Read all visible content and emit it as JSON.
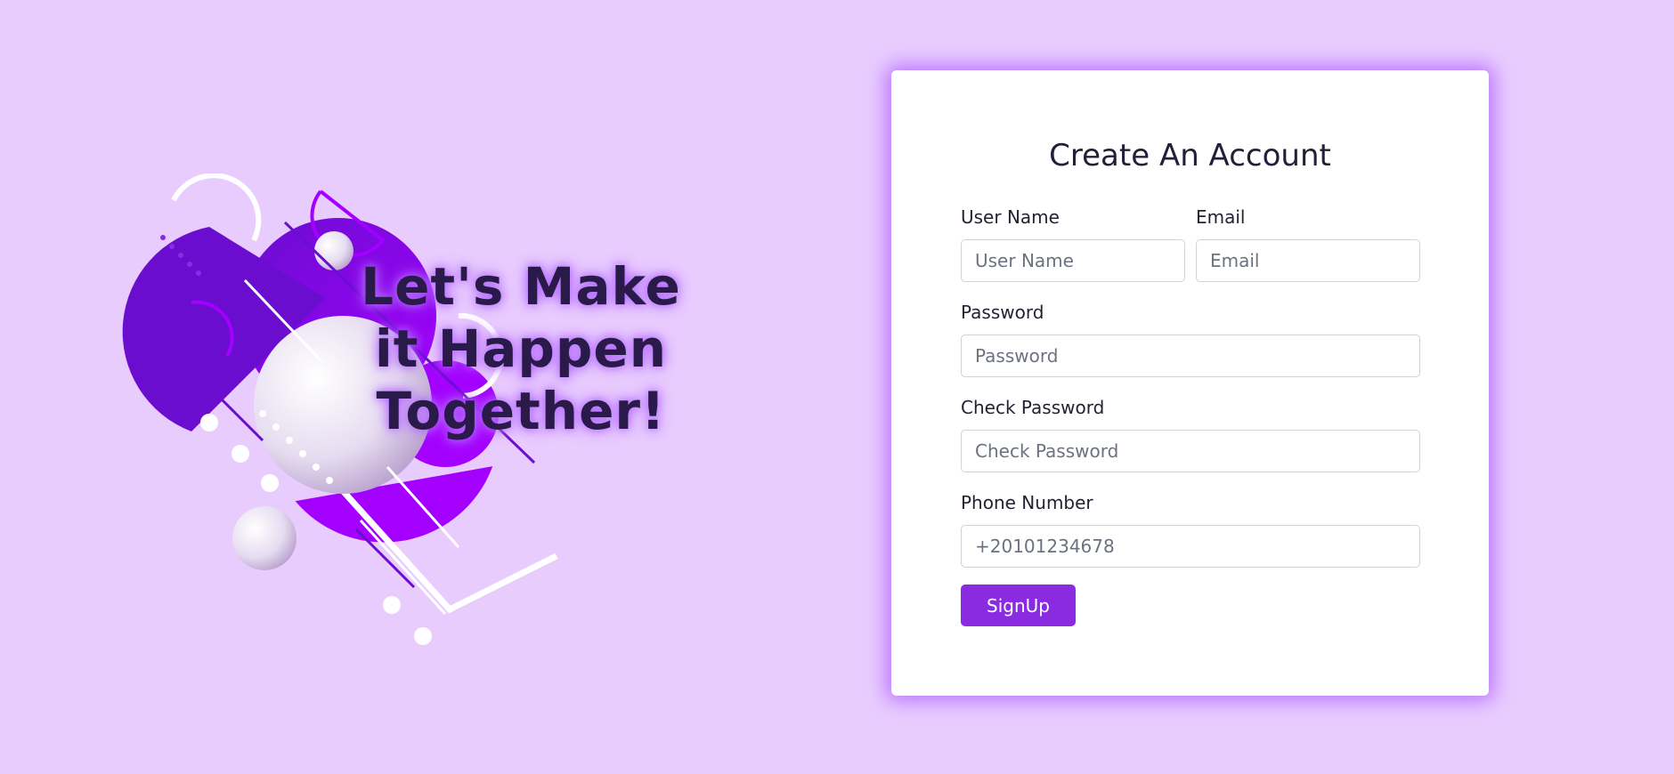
{
  "hero": {
    "slogan_line1": "Let's Make",
    "slogan_line2": "it Happen",
    "slogan_line3": "Together!"
  },
  "form": {
    "title": "Create An Account",
    "username": {
      "label": "User Name",
      "placeholder": "User Name",
      "value": ""
    },
    "email": {
      "label": "Email",
      "placeholder": "Email",
      "value": ""
    },
    "password": {
      "label": "Password",
      "placeholder": "Password",
      "value": ""
    },
    "check_password": {
      "label": "Check Password",
      "placeholder": "Check Password",
      "value": ""
    },
    "phone": {
      "label": "Phone Number",
      "placeholder": "+20101234678",
      "value": ""
    },
    "submit_label": "SignUp"
  },
  "colors": {
    "background": "#e9ccfe",
    "accent": "#8a2be2",
    "card": "#ffffff"
  },
  "icons": {
    "illustration": "abstract-geometric-shapes-illustration"
  }
}
